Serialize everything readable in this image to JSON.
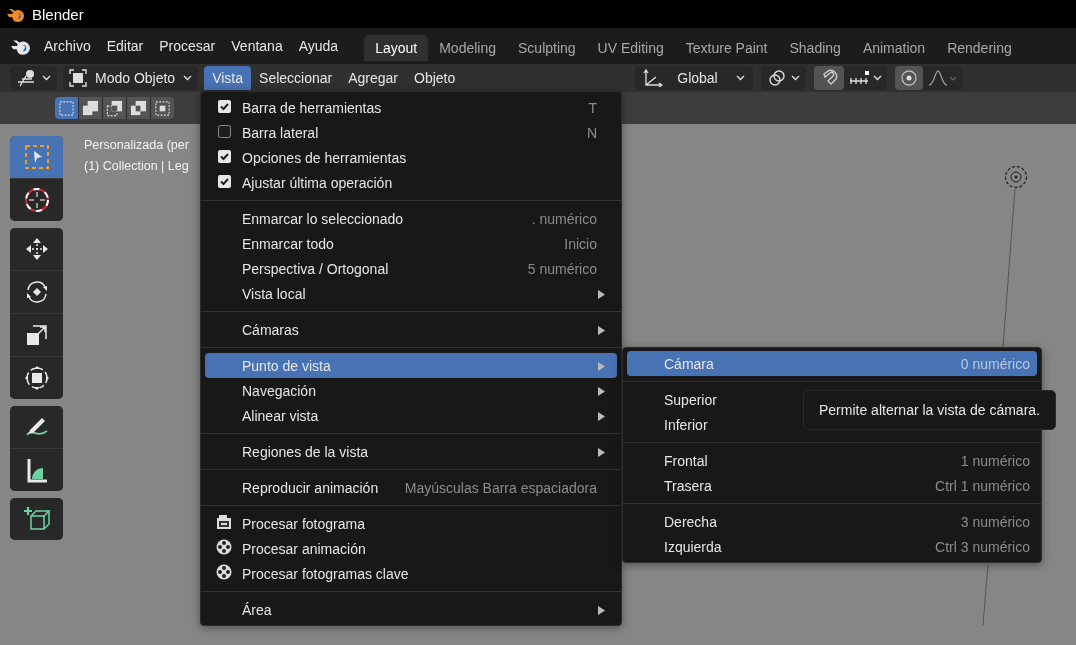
{
  "window": {
    "title": "Blender"
  },
  "topbar": {
    "menus": [
      "Archivo",
      "Editar",
      "Procesar",
      "Ventana",
      "Ayuda"
    ],
    "workspaces": [
      {
        "label": "Layout",
        "selected": true
      },
      {
        "label": "Modeling",
        "selected": false
      },
      {
        "label": "Sculpting",
        "selected": false
      },
      {
        "label": "UV Editing",
        "selected": false
      },
      {
        "label": "Texture Paint",
        "selected": false
      },
      {
        "label": "Shading",
        "selected": false
      },
      {
        "label": "Animation",
        "selected": false
      },
      {
        "label": "Rendering",
        "selected": false
      }
    ]
  },
  "header": {
    "mode": "Modo Objeto",
    "menus": [
      {
        "label": "Vista",
        "selected": true
      },
      {
        "label": "Seleccionar",
        "selected": false
      },
      {
        "label": "Agregar",
        "selected": false
      },
      {
        "label": "Objeto",
        "selected": false
      }
    ],
    "orientation": "Global",
    "snap": {
      "on": true
    },
    "proportional_editing": {
      "on": true
    }
  },
  "tool_settings": {
    "select_modes": [
      {
        "kind": "new",
        "selected": true
      },
      {
        "kind": "extend",
        "selected": false
      },
      {
        "kind": "subtract",
        "selected": false
      },
      {
        "kind": "invert",
        "selected": false
      },
      {
        "kind": "intersect",
        "selected": false
      }
    ]
  },
  "toolbar": {
    "groups": [
      [
        {
          "kind": "select",
          "selected": true
        },
        {
          "kind": "cursor",
          "selected": false
        }
      ],
      [
        {
          "kind": "move",
          "selected": false
        },
        {
          "kind": "rotate",
          "selected": false
        },
        {
          "kind": "scale",
          "selected": false
        },
        {
          "kind": "transform",
          "selected": false
        }
      ],
      [
        {
          "kind": "annotate",
          "selected": false
        },
        {
          "kind": "measure",
          "selected": false
        }
      ],
      [
        {
          "kind": "add-cube",
          "selected": false
        }
      ]
    ]
  },
  "viewport": {
    "overlay_lines": [
      "Personalizada (per",
      "(1) Collection | Leg"
    ]
  },
  "view_menu": {
    "sections": [
      [
        {
          "kind": "check",
          "label": "Barra de herramientas",
          "shortcut": "T",
          "checked": true,
          "selected": false
        },
        {
          "kind": "check",
          "label": "Barra lateral",
          "shortcut": "N",
          "checked": false,
          "selected": false
        },
        {
          "kind": "check",
          "label": "Opciones de herramientas",
          "checked": true,
          "selected": false
        },
        {
          "kind": "check",
          "label": "Ajustar última operación",
          "checked": true,
          "selected": false
        }
      ],
      [
        {
          "kind": "plain",
          "label": "Enmarcar lo seleccionado",
          "shortcut": ". numérico",
          "selected": false
        },
        {
          "kind": "plain",
          "label": "Enmarcar todo",
          "shortcut": "Inicio",
          "selected": false
        },
        {
          "kind": "plain",
          "label": "Perspectiva / Ortogonal",
          "shortcut": "5 numérico",
          "selected": false
        },
        {
          "kind": "submenu",
          "label": "Vista local",
          "selected": false
        }
      ],
      [
        {
          "kind": "submenu",
          "label": "Cámaras",
          "selected": false
        }
      ],
      [
        {
          "kind": "submenu",
          "label": "Punto de vista",
          "selected": true
        },
        {
          "kind": "submenu",
          "label": "Navegación",
          "selected": false
        },
        {
          "kind": "submenu",
          "label": "Alinear vista",
          "selected": false
        }
      ],
      [
        {
          "kind": "submenu",
          "label": "Regiones de la vista",
          "selected": false
        }
      ],
      [
        {
          "kind": "plain",
          "label": "Reproducir animación",
          "shortcut": "Mayúsculas Barra espaciadora",
          "selected": false
        }
      ],
      [
        {
          "kind": "render-still",
          "label": "Procesar fotograma",
          "selected": false
        },
        {
          "kind": "render-anim",
          "label": "Procesar animación",
          "selected": false
        },
        {
          "kind": "render-anim",
          "label": "Procesar fotogramas clave",
          "selected": false
        }
      ],
      [
        {
          "kind": "submenu",
          "label": "Área",
          "selected": false
        }
      ]
    ]
  },
  "viewpoint_menu": {
    "sections": [
      [
        {
          "label": "Cámara",
          "shortcut": "0 numérico",
          "selected": true
        }
      ],
      [
        {
          "label": "Superior",
          "selected": false
        },
        {
          "label": "Inferior",
          "selected": false
        }
      ],
      [
        {
          "label": "Frontal",
          "shortcut": "1 numérico",
          "selected": false
        },
        {
          "label": "Trasera",
          "shortcut": "Ctrl 1 numérico",
          "selected": false
        }
      ],
      [
        {
          "label": "Derecha",
          "shortcut": "3 numérico",
          "selected": false
        },
        {
          "label": "Izquierda",
          "shortcut": "Ctrl 3 numérico",
          "selected": false
        }
      ]
    ]
  },
  "tooltip": "Permite alternar la vista de cámara."
}
